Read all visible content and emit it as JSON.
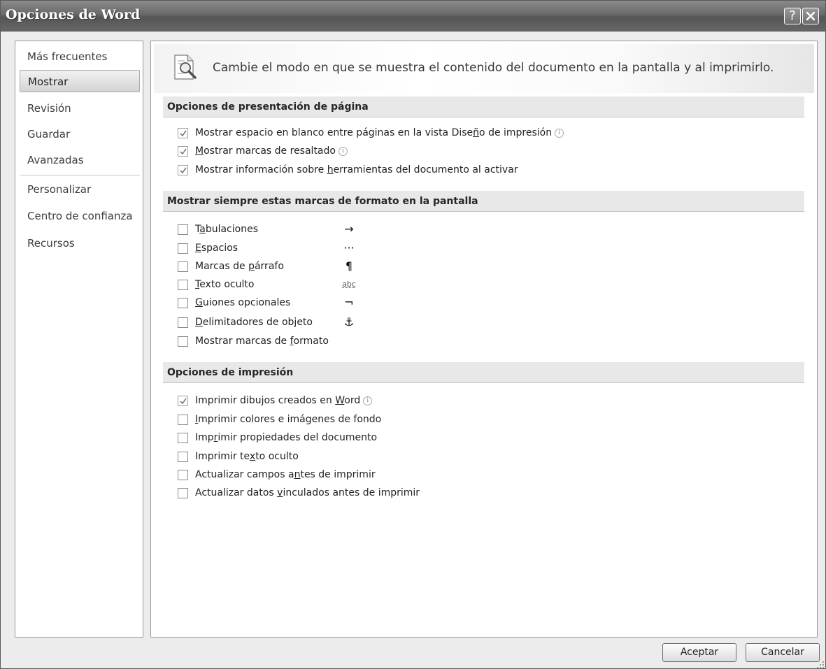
{
  "window": {
    "title": "Opciones de Word",
    "help_label": "?"
  },
  "sidebar": {
    "items": [
      {
        "label": "Más frecuentes"
      },
      {
        "label": "Mostrar"
      },
      {
        "label": "Revisión"
      },
      {
        "label": "Guardar"
      },
      {
        "label": "Avanzadas"
      },
      {
        "label": "Personalizar"
      },
      {
        "label": "Centro de confianza"
      },
      {
        "label": "Recursos"
      }
    ],
    "selected": "Mostrar"
  },
  "banner": {
    "text": "Cambie el modo en que se muestra el contenido del documento en la pantalla y al imprimirlo.",
    "icon": "document-magnifier-icon"
  },
  "page_options": {
    "header": "Opciones de presentación de página",
    "items": [
      {
        "pre": "Mostrar espacio en blanco entre páginas en la vista Dise",
        "key": "ñ",
        "post": "o de impresión",
        "checked": true,
        "info": true
      },
      {
        "pre": "",
        "key": "M",
        "post": "ostrar marcas de resaltado",
        "checked": true,
        "info": true
      },
      {
        "pre": "Mostrar información sobre ",
        "key": "h",
        "post": "erramientas del documento al activar",
        "checked": true,
        "info": false
      }
    ]
  },
  "format_marks": {
    "header": "Mostrar siempre estas marcas de formato en la pantalla",
    "items": [
      {
        "pre": "T",
        "key": "a",
        "post": "bulaciones",
        "checked": false,
        "symbol": "→"
      },
      {
        "pre": "",
        "key": "E",
        "post": "spacios",
        "checked": false,
        "symbol": "···"
      },
      {
        "pre": "Marcas de ",
        "key": "p",
        "post": "árrafo",
        "checked": false,
        "symbol": "¶"
      },
      {
        "pre": "",
        "key": "T",
        "post": "exto oculto",
        "checked": false,
        "symbol": "abc"
      },
      {
        "pre": "",
        "key": "G",
        "post": "uiones opcionales",
        "checked": false,
        "symbol": "¬"
      },
      {
        "pre": "",
        "key": "D",
        "post": "elimitadores de objeto",
        "checked": false,
        "symbol": "⚓"
      },
      {
        "pre": "Mostrar marcas de ",
        "key": "f",
        "post": "ormato",
        "checked": false,
        "symbol": ""
      }
    ]
  },
  "print_options": {
    "header": "Opciones de impresión",
    "items": [
      {
        "pre": "Imprimir dibujos creados en ",
        "key": "W",
        "post": "ord",
        "checked": true,
        "info": true
      },
      {
        "pre": "",
        "key": "I",
        "post": "mprimir colores e imágenes de fondo",
        "checked": false,
        "info": false
      },
      {
        "pre": "Imp",
        "key": "r",
        "post": "imir propiedades del documento",
        "checked": false,
        "info": false
      },
      {
        "pre": "Imprimir te",
        "key": "x",
        "post": "to oculto",
        "checked": false,
        "info": false
      },
      {
        "pre": "Actualizar campos a",
        "key": "n",
        "post": "tes de imprimir",
        "checked": false,
        "info": false
      },
      {
        "pre": "Actualizar datos ",
        "key": "v",
        "post": "inculados antes de imprimir",
        "checked": false,
        "info": false
      }
    ]
  },
  "footer": {
    "ok_label": "Aceptar",
    "cancel_label": "Cancelar"
  }
}
